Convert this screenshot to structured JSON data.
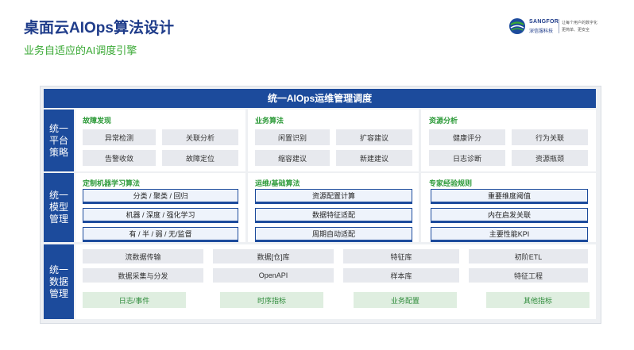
{
  "title": "桌面云AIOps算法设计",
  "subtitle": "业务自适应的AI调度引擎",
  "logo": {
    "brand": "SANGFOR",
    "brand_cn": "深信服科技",
    "tagline1": "让每个用户的数字化",
    "tagline2": "更简单、更安全"
  },
  "header": "统一AIOps运维管理调度",
  "rows": {
    "policy": {
      "label": "统一平台策略",
      "sections": [
        {
          "title": "故障发现",
          "items": [
            "异常检测",
            "关联分析",
            "告警收敛",
            "故障定位"
          ]
        },
        {
          "title": "业务算法",
          "items": [
            "闲置识别",
            "扩容建议",
            "缩容建议",
            "新建建议"
          ]
        },
        {
          "title": "资源分析",
          "items": [
            "健康评分",
            "行为关联",
            "日志诊断",
            "资源瓶颈"
          ]
        }
      ]
    },
    "model": {
      "label": "统一模型管理",
      "sections": [
        {
          "title": "定制机器学习算法",
          "items": [
            "分类 / 聚类 / 回归",
            "机器 / 深度 / 强化学习",
            "有 / 半 / 弱 / 无/监督"
          ]
        },
        {
          "title": "运维/基础算法",
          "items": [
            "资源配置计算",
            "数据特征适配",
            "周期自动适配"
          ]
        },
        {
          "title": "专家经验规则",
          "items": [
            "重要维度阈值",
            "内在启发关联",
            "主要性能KPI"
          ]
        }
      ]
    },
    "data": {
      "label": "统一数据管理",
      "grid": [
        [
          "流数据传输",
          "数据[仓]库",
          "特征库",
          "初阶ETL"
        ],
        [
          "数据采集与分发",
          "OpenAPI",
          "样本库",
          "特征工程"
        ]
      ],
      "green": [
        "日志/事件",
        "时序指标",
        "业务配置",
        "其他指标"
      ]
    }
  },
  "colors": {
    "primary": "#1c4b9c",
    "accent_green": "#2e9b3a",
    "chip_gray": "#e7e9ee"
  }
}
